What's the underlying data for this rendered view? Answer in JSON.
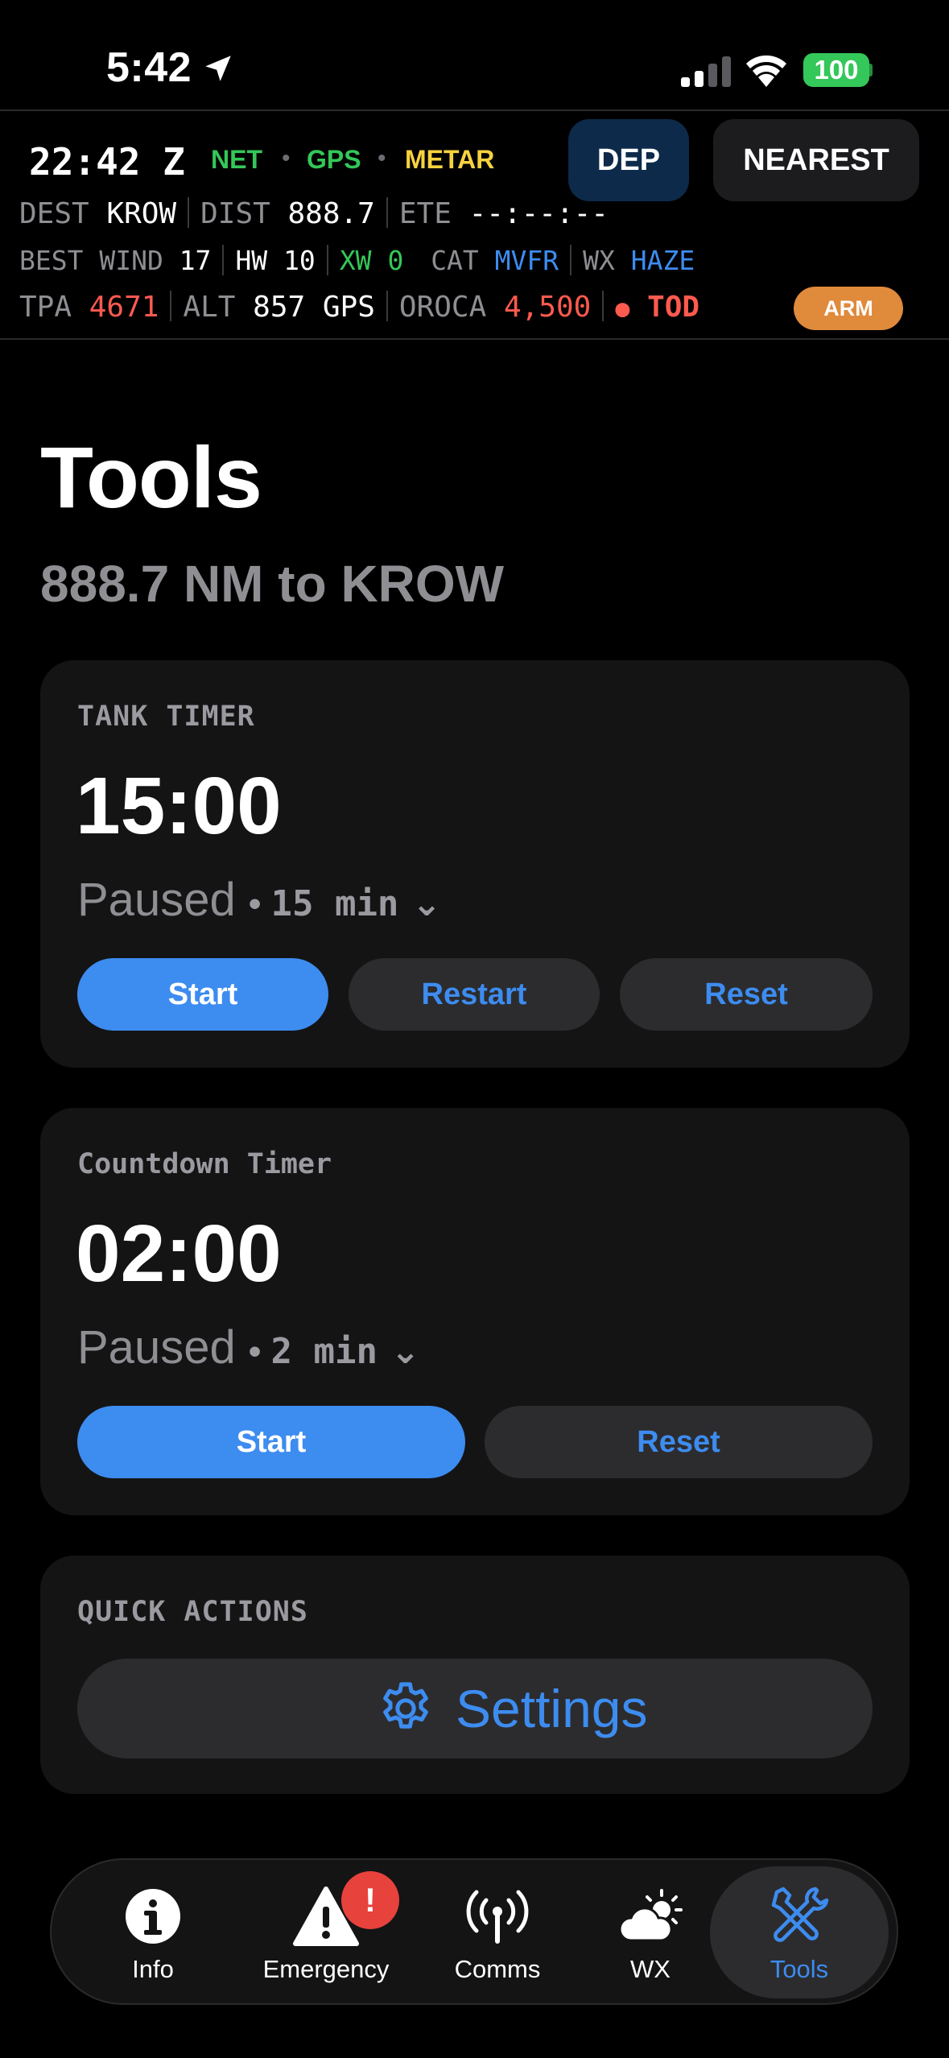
{
  "status_bar": {
    "time": "5:42",
    "battery": "100"
  },
  "flight_header": {
    "zulu_time": "22:42 Z",
    "sources": [
      "NET",
      "GPS",
      "METAR"
    ],
    "source_colors": [
      "#34c759",
      "#34c759",
      "#f7d23e"
    ],
    "dep_label": "DEP",
    "nearest_label": "NEAREST",
    "dest_label": "DEST",
    "dest_value": "KROW",
    "dist_label": "DIST",
    "dist_value": "888.7",
    "ete_label": "ETE",
    "ete_value": "--:--:--",
    "best_wind_label": "BEST WIND",
    "best_wind_value": "17",
    "hw_label": "HW",
    "hw_value": "10",
    "xw_label": "XW",
    "xw_value": "0",
    "cat_label": "CAT",
    "cat_value": "MVFR",
    "wx_label": "WX",
    "wx_value": "HAZE",
    "tpa_label": "TPA",
    "tpa_value": "4671",
    "alt_label": "ALT",
    "alt_value": "857",
    "alt_source": "GPS",
    "oroca_label": "OROCA",
    "oroca_value": "4,500",
    "tod_label": "TOD",
    "arm_label": "ARM"
  },
  "page": {
    "title": "Tools",
    "subtitle": "888.7 NM to KROW"
  },
  "tank_timer": {
    "label": "TANK TIMER",
    "time": "15:00",
    "status": "Paused",
    "duration": "15 min",
    "start_label": "Start",
    "restart_label": "Restart",
    "reset_label": "Reset"
  },
  "countdown_timer": {
    "label": "Countdown Timer",
    "time": "02:00",
    "status": "Paused",
    "duration": "2 min",
    "start_label": "Start",
    "reset_label": "Reset"
  },
  "quick_actions": {
    "label": "QUICK ACTIONS",
    "settings_label": "Settings",
    "settings_icon": "gear-icon"
  },
  "tab_bar": {
    "items": [
      {
        "label": "Info",
        "icon": "info-icon"
      },
      {
        "label": "Emergency",
        "icon": "warning-icon"
      },
      {
        "label": "Comms",
        "icon": "antenna-icon"
      },
      {
        "label": "WX",
        "icon": "weather-icon"
      },
      {
        "label": "Tools",
        "icon": "tools-icon"
      }
    ],
    "active": "Tools",
    "emergency_badge": "!"
  },
  "colors": {
    "accent": "#3d8cf0",
    "alert_red": "#ff5a4f",
    "green": "#34c759",
    "amber": "#f7d23e",
    "arm_orange": "#e08a3c"
  }
}
